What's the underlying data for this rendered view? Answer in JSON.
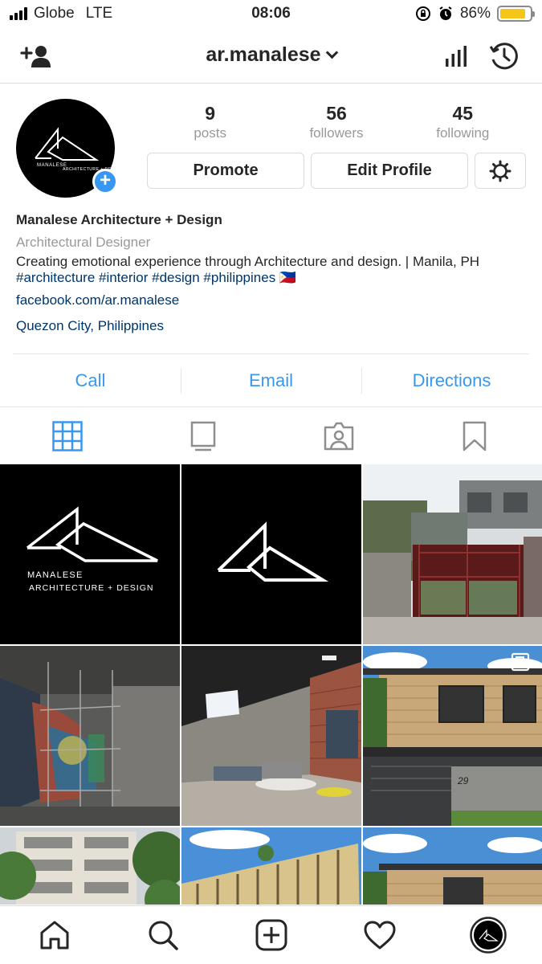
{
  "status_bar": {
    "carrier": "Globe",
    "network": "LTE",
    "time": "08:06",
    "battery_percent": "86%",
    "battery_level": 0.86
  },
  "header": {
    "username": "ar.manalese",
    "icons": [
      "add-user-icon",
      "insights-icon",
      "archive-clock-icon"
    ]
  },
  "profile": {
    "avatar_logo": {
      "line1": "MANALESE",
      "line2": "ARCHITECTURE + DESIGN"
    },
    "stats": [
      {
        "value": "9",
        "label": "posts"
      },
      {
        "value": "56",
        "label": "followers"
      },
      {
        "value": "45",
        "label": "following"
      }
    ],
    "buttons": {
      "promote": "Promote",
      "edit_profile": "Edit Profile"
    },
    "name": "Manalese Architecture + Design",
    "category": "Architectural Designer",
    "bio": "Creating emotional experience through Architecture and design. | Manila, PH",
    "hashtags": "#architecture #interior #design #philippines 🇵🇭",
    "website": "facebook.com/ar.manalese",
    "location": "Quezon City, Philippines"
  },
  "contact_buttons": [
    "Call",
    "Email",
    "Directions"
  ],
  "tabs": [
    "grid-icon",
    "igtv-icon",
    "tagged-icon",
    "saved-icon"
  ],
  "grid_posts": [
    {
      "kind": "logo-text",
      "line1": "MANALESE",
      "line2": "ARCHITECTURE + DESIGN"
    },
    {
      "kind": "logo"
    },
    {
      "kind": "photo-site"
    },
    {
      "kind": "photo-interior-wall"
    },
    {
      "kind": "render-loft"
    },
    {
      "kind": "render-house",
      "house_number": "29",
      "multi": true
    },
    {
      "kind": "photo-building"
    },
    {
      "kind": "photo-building-facade"
    },
    {
      "kind": "render-house-2"
    }
  ],
  "bottom_nav": [
    "home-icon",
    "search-icon",
    "new-post-icon",
    "activity-heart-icon",
    "profile-avatar"
  ],
  "colors": {
    "accent_blue": "#3897f0",
    "link_dark_blue": "#003569",
    "border": "#dbdbdb",
    "muted_text": "#999999",
    "battery_yellow": "#f5c518"
  }
}
